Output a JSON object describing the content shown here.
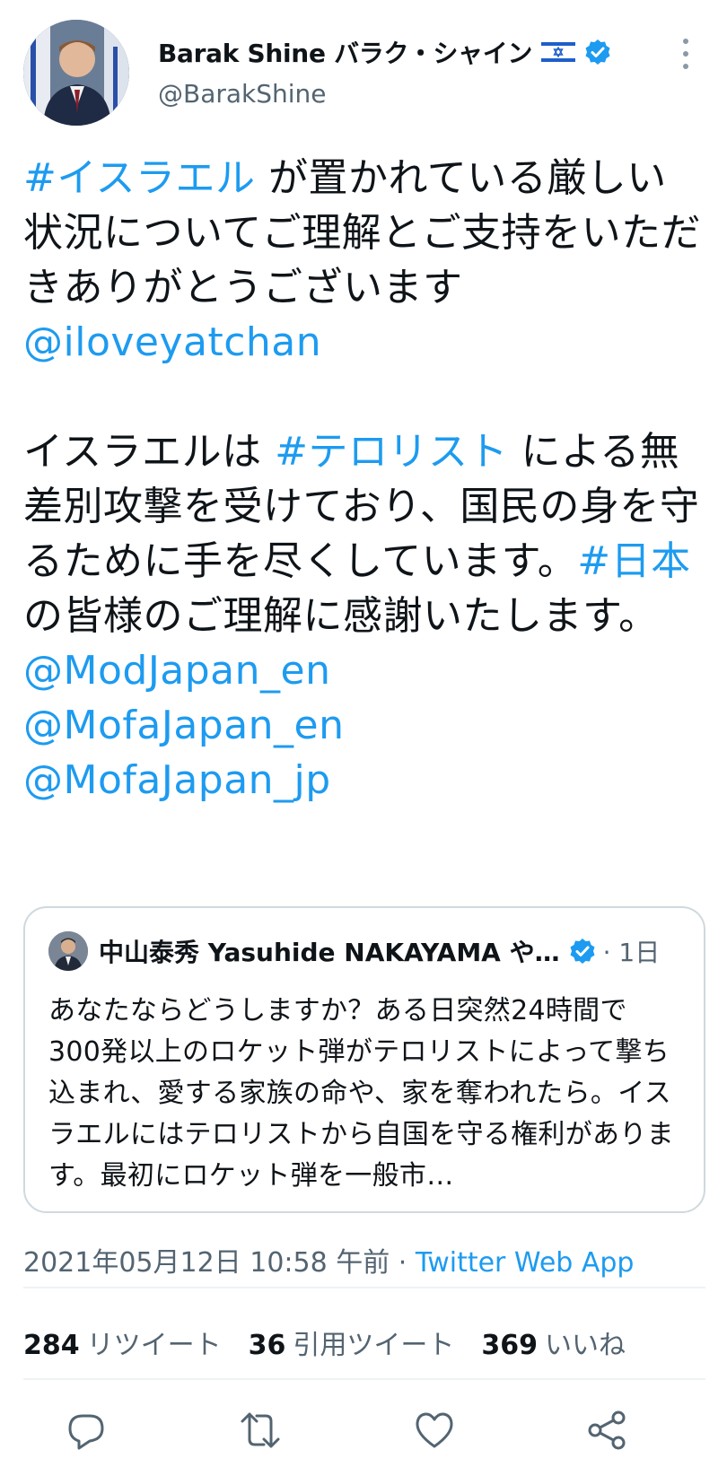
{
  "author": {
    "display_name": "Barak Shine バラク・シャイン",
    "handle": "@BarakShine",
    "flag": "israel-flag-icon",
    "verified_color": "#1d9bf0"
  },
  "tweet": {
    "paragraph1": [
      {
        "text": "#イスラエル",
        "link": true
      },
      {
        "text": " が置かれている厳しい状況についてご理解とご支持をいただきありがとうございます",
        "link": false
      }
    ],
    "mention1": "@iloveyatchan",
    "paragraph2": [
      {
        "text": "イスラエルは ",
        "link": false
      },
      {
        "text": "#テロリスト",
        "link": true
      },
      {
        "text": " による無差別攻撃を受けており、国民の身を守るために手を尽くしています。",
        "link": false
      },
      {
        "text": "#日本",
        "link": true
      },
      {
        "text": " の皆様のご理解に感謝いたします。",
        "link": false
      }
    ],
    "mentions": [
      "@ModJapan_en",
      "@MofaJapan_en",
      "@MofaJapan_jp"
    ]
  },
  "quote": {
    "name": "中山泰秀 Yasuhide NAKAYAMA や…",
    "time": "· 1日",
    "text": "あなたならどうしますか？ある日突然24時間で300発以上のロケット弾がテロリストによって撃ち込まれ、愛する家族の命や、家を奪われたら。イスラエルにはテロリストから自国を守る権利があります。最初にロケット弾を一般市…"
  },
  "meta": {
    "timestamp": "2021年05月12日 10:58 午前 · ",
    "source": "Twitter Web App"
  },
  "stats": {
    "retweets": "284",
    "retweets_label": "リツイート",
    "quotes": "36",
    "quotes_label": "引用ツイート",
    "likes": "369",
    "likes_label": "いいね"
  },
  "colors": {
    "link": "#1d9bf0",
    "secondary_text": "#536471",
    "border": "#cfd9de"
  },
  "actions": [
    "reply-icon",
    "retweet-icon",
    "like-icon",
    "share-icon"
  ]
}
